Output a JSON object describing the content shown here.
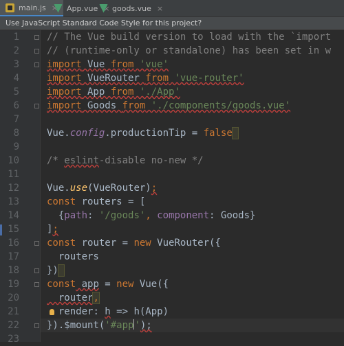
{
  "tabs": [
    {
      "label": "main.js",
      "icon": "js-file-icon",
      "active": true
    },
    {
      "label": "App.vue",
      "icon": "vue-file-icon",
      "active": false
    },
    {
      "label": "goods.vue",
      "icon": "vue-file-icon",
      "active": false
    }
  ],
  "banner": {
    "text": "Use JavaScript Standard Code Style for this project?"
  },
  "line_numbers": [
    "1",
    "2",
    "3",
    "4",
    "5",
    "6",
    "7",
    "8",
    "9",
    "10",
    "11",
    "12",
    "13",
    "14",
    "15",
    "16",
    "17",
    "18",
    "19",
    "20",
    "21",
    "22",
    "23"
  ],
  "code": {
    "l1_comment": "// The Vue build version to load with the `import",
    "l2_comment": "// (runtime-only or standalone) has been set in w",
    "l3_import": "import",
    "l3_name": " Vue ",
    "l3_from": "from",
    "l3_path": " 'vue'",
    "l4_import": "import",
    "l4_name": " VueRouter ",
    "l4_from": "from",
    "l4_path": " 'vue-router'",
    "l5_import": "import",
    "l5_name": " App ",
    "l5_from": "from",
    "l5_path": " './App'",
    "l6_import": "import",
    "l6_name": " Goods ",
    "l6_from": "from",
    "l6_path": " './components/goods.vue'",
    "l8_vue": "Vue.",
    "l8_config": "config",
    "l8_dot": ".",
    "l8_tip": "productionTip",
    "l8_eq": " = ",
    "l8_false": "false",
    "l10_open": "/* ",
    "l10_eslint": "eslint",
    "l10_rest": "-disable no-new */",
    "l12_vue": "Vue.",
    "l12_use": "use",
    "l12_args": "(VueRouter)",
    "l12_semi": ";",
    "l13_const": "const",
    "l13_rest": " routers = [",
    "l14_indent": "  {",
    "l14_path": "path",
    "l14_colon": ": ",
    "l14_pathval": "'/goods'",
    "l14_comma": ", ",
    "l14_comp": "component",
    "l14_compval": ": Goods}",
    "l15_close": "]",
    "l15_semi": ";",
    "l16_const": "const",
    "l16_mid": " router = ",
    "l16_new": "new",
    "l16_rest": " VueRouter({",
    "l17_routers": "  routers",
    "l18_close": "})",
    "l19_const": "const",
    "l19_app": " app",
    "l19_mid": " = ",
    "l19_new": "new",
    "l19_rest": " Vue({",
    "l20_router": "  router",
    "l20_comma": ",",
    "l21_render": "  render",
    "l21_colon": ": ",
    "l21_h": "h",
    "l21_arrow": " => h(App)",
    "l22_start": "}).$mount(",
    "l22_str1": "'#app",
    "l22_str2": "'",
    "l22_end": ");"
  }
}
